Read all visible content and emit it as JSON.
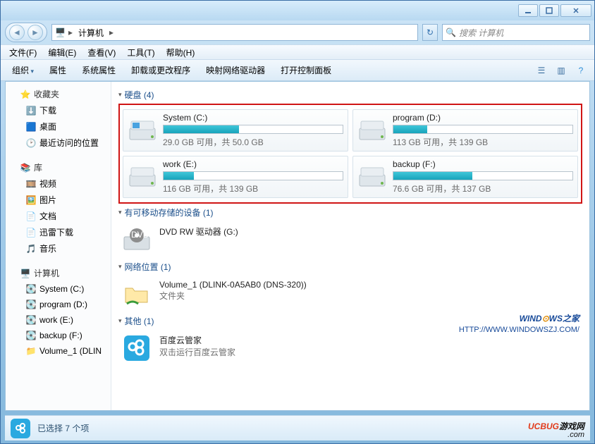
{
  "title": "计算机",
  "address": {
    "root_icon": "computer-icon",
    "crumb": "计算机"
  },
  "search": {
    "placeholder": "搜索 计算机"
  },
  "menus": [
    "文件(F)",
    "编辑(E)",
    "查看(V)",
    "工具(T)",
    "帮助(H)"
  ],
  "toolbar": {
    "organize": "组织",
    "properties": "属性",
    "system_properties": "系统属性",
    "uninstall": "卸载或更改程序",
    "map_drive": "映射网络驱动器",
    "control_panel": "打开控制面板"
  },
  "sidebar": {
    "favorites": {
      "label": "收藏夹",
      "items": [
        "下载",
        "桌面",
        "最近访问的位置"
      ]
    },
    "libraries": {
      "label": "库",
      "items": [
        "视频",
        "图片",
        "文档",
        "迅雷下载",
        "音乐"
      ]
    },
    "computer": {
      "label": "计算机",
      "items": [
        "System (C:)",
        "program (D:)",
        "work (E:)",
        "backup (F:)",
        "Volume_1 (DLIN"
      ]
    }
  },
  "sections": {
    "hdd": {
      "title": "硬盘 (4)",
      "drives": [
        {
          "name": "System (C:)",
          "free": "29.0 GB",
          "total": "50.0 GB",
          "used_pct": 42
        },
        {
          "name": "program (D:)",
          "free": "113 GB",
          "total": "139 GB",
          "used_pct": 19
        },
        {
          "name": "work (E:)",
          "free": "116 GB",
          "total": "139 GB",
          "used_pct": 17
        },
        {
          "name": "backup (F:)",
          "free": "76.6 GB",
          "total": "137 GB",
          "used_pct": 44
        }
      ]
    },
    "removable": {
      "title": "有可移动存储的设备 (1)",
      "item": {
        "name": "DVD RW 驱动器 (G:)"
      }
    },
    "network": {
      "title": "网络位置 (1)",
      "item": {
        "name": "Volume_1 (DLINK-0A5AB0 (DNS-320))",
        "sub": "文件夹"
      }
    },
    "other": {
      "title": "其他 (1)",
      "item": {
        "name": "百度云管家",
        "sub": "双击运行百度云管家"
      }
    }
  },
  "status": {
    "text": "已选择 7 个项"
  },
  "watermark1": {
    "line1_a": "WIND",
    "line1_b": "WS",
    "line1_c": "之家",
    "line2": "HTTP://WWW.WINDOWSZJ.COM/"
  },
  "watermark2": {
    "a": "UCBUG",
    "b": "游戏网",
    "c": ".com"
  },
  "strings": {
    "free_sep": " 可用，共 "
  }
}
